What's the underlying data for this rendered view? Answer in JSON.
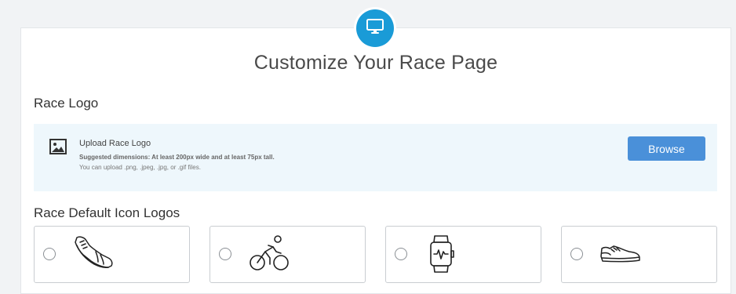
{
  "header": {
    "icon": "monitor-icon",
    "title": "Customize Your Race Page"
  },
  "race_logo": {
    "section_title": "Race Logo",
    "upload_icon": "image-icon",
    "upload_label": "Upload Race Logo",
    "hint": "Suggested dimensions: At least 200px wide and at least 75px tall.",
    "formats": "You can upload .png, .jpeg, .jpg, or .gif files.",
    "browse_label": "Browse"
  },
  "default_icons": {
    "section_title": "Race Default Icon Logos",
    "options": [
      {
        "icon": "running-shoe-icon",
        "selected": false
      },
      {
        "icon": "cyclist-icon",
        "selected": false
      },
      {
        "icon": "fitness-watch-icon",
        "selected": false
      },
      {
        "icon": "sneaker-icon",
        "selected": false
      }
    ]
  },
  "colors": {
    "accent": "#1a9bd7",
    "button": "#4a90d9",
    "upload_bg": "#eef7fc"
  }
}
